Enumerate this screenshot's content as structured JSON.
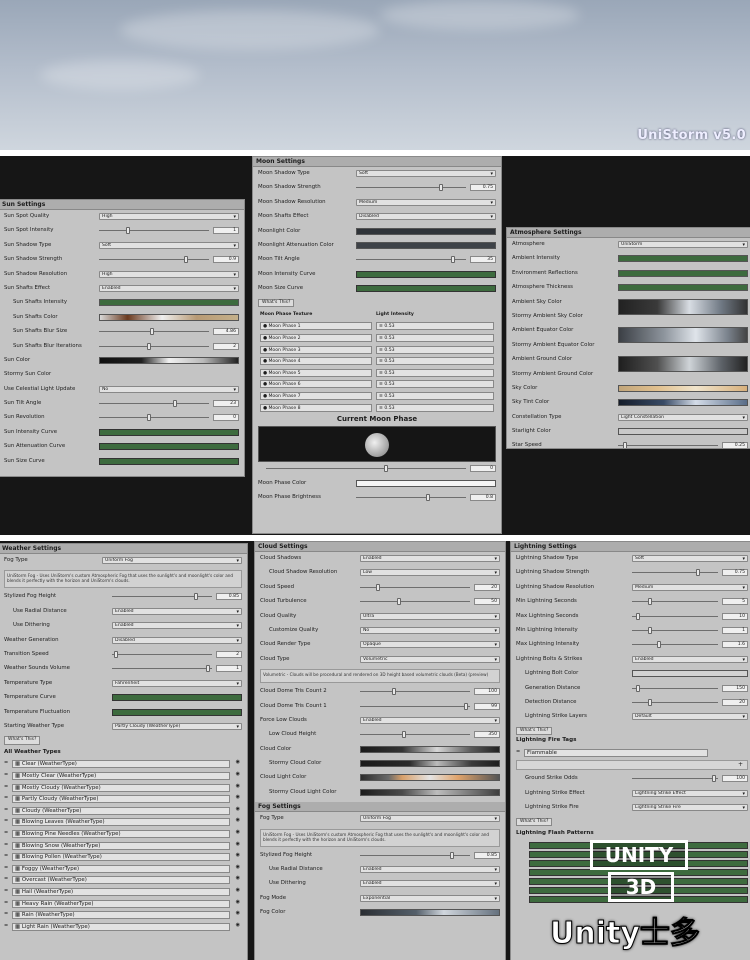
{
  "brand": "UniStorm v5.0",
  "sun": {
    "title": "Sun Settings",
    "rows": [
      {
        "label": "Sun Spot Quality",
        "kind": "dd",
        "value": "High"
      },
      {
        "label": "Sun Spot Intensity",
        "kind": "sl",
        "value": "1",
        "pos": 0.25
      },
      {
        "label": "Sun Shadow Type",
        "kind": "dd",
        "value": "Soft"
      },
      {
        "label": "Sun Shadow Strength",
        "kind": "sl",
        "value": "0.9",
        "pos": 0.8
      },
      {
        "label": "Sun Shadow Resolution",
        "kind": "dd",
        "value": "High"
      },
      {
        "label": "Sun Shafts Effect",
        "kind": "dd",
        "value": "Enabled"
      },
      {
        "label": "Sun Shafts Intensity",
        "kind": "color",
        "color": "#3d6b3e",
        "ind": true
      },
      {
        "label": "Sun Shafts Color",
        "kind": "grad",
        "color": "linear-gradient(90deg,#d8d8d8,#6b3a1f 20%,#efefef 45%,#b89a75 70%,#c4b08a)",
        "ind": true
      },
      {
        "label": "Sun Shafts Blur Size",
        "kind": "sl",
        "value": "4.86",
        "pos": 0.48,
        "ind": true
      },
      {
        "label": "Sun Shafts Blur Iterations",
        "kind": "sl",
        "value": "2",
        "pos": 0.45,
        "ind": true
      },
      {
        "label": "Sun Color",
        "kind": "grad",
        "color": "linear-gradient(90deg,#101010,#202020 30%,#f1f1f1 50%,#b9b9b9 75%,#222)"
      },
      {
        "label": "Stormy Sun Color",
        "kind": "none"
      },
      {
        "label": "Use Celestial Light Update",
        "kind": "dd",
        "value": "No"
      },
      {
        "label": "Sun Tilt Angle",
        "kind": "sl",
        "value": "23",
        "pos": 0.7
      },
      {
        "label": "Sun Revolution",
        "kind": "sl",
        "value": "0",
        "pos": 0.45
      },
      {
        "label": "Sun Intensity Curve",
        "kind": "curve"
      },
      {
        "label": "Sun Attenuation Curve",
        "kind": "curve"
      },
      {
        "label": "Sun Size Curve",
        "kind": "curve"
      }
    ]
  },
  "moon": {
    "title": "Moon Settings",
    "rows": [
      {
        "label": "Moon Shadow Type",
        "kind": "dd",
        "value": "Soft"
      },
      {
        "label": "Moon Shadow Strength",
        "kind": "sl",
        "value": "0.75",
        "pos": 0.78
      },
      {
        "label": "Moon Shadow Resolution",
        "kind": "dd",
        "value": "Medium"
      },
      {
        "label": "Moon Shafts Effect",
        "kind": "dd",
        "value": "Disabled"
      },
      {
        "label": "Moonlight Color",
        "kind": "color",
        "color": "#2f3338"
      },
      {
        "label": "Moonlight Attenuation Color",
        "kind": "color",
        "color": "#3e4248"
      },
      {
        "label": "Moon Tilt Angle",
        "kind": "sl",
        "value": "35",
        "pos": 0.9
      },
      {
        "label": "Moon Intensity Curve",
        "kind": "curve"
      },
      {
        "label": "Moon Size Curve",
        "kind": "curve"
      }
    ],
    "whats_this": "What's This?",
    "col_feature": "Moon Phase Texture",
    "col_intensity": "Light Intensity",
    "phases": [
      {
        "name": "Moon Phase 1",
        "val": "0.53"
      },
      {
        "name": "Moon Phase 2",
        "val": "0.53"
      },
      {
        "name": "Moon Phase 3",
        "val": "0.53"
      },
      {
        "name": "Moon Phase 4",
        "val": "0.53"
      },
      {
        "name": "Moon Phase 5",
        "val": "0.53"
      },
      {
        "name": "Moon Phase 6",
        "val": "0.53"
      },
      {
        "name": "Moon Phase 7",
        "val": "0.53"
      },
      {
        "name": "Moon Phase 8",
        "val": "0.53"
      }
    ],
    "current_phase": "Current Moon Phase",
    "phase_slider": "0",
    "phase_color_label": "Moon Phase Color",
    "phase_brightness_label": "Moon Phase Brightness",
    "phase_brightness": "0.8"
  },
  "atmo": {
    "title": "Atmosphere Settings",
    "rows": [
      {
        "label": "Atmosphere",
        "kind": "dd",
        "value": "UniStorm"
      },
      {
        "label": "Ambient Intensity",
        "kind": "color",
        "color": "#3d6b3e"
      },
      {
        "label": "Environment Reflections",
        "kind": "color",
        "color": "#3d6b3e"
      },
      {
        "label": "Atmosphere Thickness",
        "kind": "color",
        "color": "#3d6b3e"
      },
      {
        "label": "Ambient Sky Color",
        "kind": "grad2",
        "color": "linear-gradient(90deg,#222,#3a3a3a 30%,#d8dde3 55%,#6f7883 80%,#333)"
      },
      {
        "label": "Stormy Ambient Sky Color",
        "kind": "none"
      },
      {
        "label": "Ambient Equator Color",
        "kind": "grad2",
        "color": "linear-gradient(90deg,#3b3f45,#8d949c 35%,#dfe4ea 60%,#7a828c 85%,#444)"
      },
      {
        "label": "Stormy Ambient Equator Color",
        "kind": "none"
      },
      {
        "label": "Ambient Ground Color",
        "kind": "grad2",
        "color": "linear-gradient(90deg,#1f1f1f,#505050 30%,#cfd4d8 55%,#5d6268 80%,#222)"
      },
      {
        "label": "Stormy Ambient Ground Color",
        "kind": "none"
      },
      {
        "label": "Sky Color",
        "kind": "grad",
        "color": "linear-gradient(90deg,#c1a57a,#e1c08e 30%,#f0e4cb 60%,#d8b07c)"
      },
      {
        "label": "Sky Tint Color",
        "kind": "grad",
        "color": "linear-gradient(90deg,#141c2a,#394b66 35%,#d4dce8 60%,#596d88)"
      },
      {
        "label": "Constellation Type",
        "kind": "dd",
        "value": "Light Constellation"
      },
      {
        "label": "Starlight Color",
        "kind": "color",
        "color": "#c9c9c9"
      },
      {
        "label": "Star Speed",
        "kind": "sl",
        "value": "0.25",
        "pos": 0.05
      }
    ]
  },
  "weather": {
    "title": "Weather Settings",
    "fog_type_label": "Fog Type",
    "fog_type": "Uniform Fog",
    "help": "UniStorm Fog - Uses UniStorm's custom Atmospheric Fog that uses the sunlight's and moonlight's color and blends it perfectly with the horizon and UniStorm's clouds.",
    "rows": [
      {
        "label": "Stylized Fog Height",
        "kind": "sl",
        "value": "0.85",
        "pos": 0.85
      },
      {
        "label": "Use Radial Distance",
        "kind": "dd",
        "value": "Enabled",
        "ind": true
      },
      {
        "label": "Use Dithering",
        "kind": "dd",
        "value": "Enabled",
        "ind": true
      },
      {
        "label": "Weather Generation",
        "kind": "dd",
        "value": "Disabled"
      },
      {
        "label": "Transition Speed",
        "kind": "sl",
        "value": "2",
        "pos": 0.02
      },
      {
        "label": "Weather Sounds Volume",
        "kind": "sl",
        "value": "1",
        "pos": 0.98
      },
      {
        "label": "Temperature Type",
        "kind": "dd",
        "value": "Fahrenheit"
      },
      {
        "label": "Temperature Curve",
        "kind": "curve"
      },
      {
        "label": "Temperature Fluctuation",
        "kind": "curve"
      },
      {
        "label": "Starting Weather Type",
        "kind": "dd",
        "value": "Partly Cloudy (WeatherType)"
      }
    ],
    "whats_this": "What's This?",
    "all_types": "All Weather Types",
    "types": [
      "Clear (WeatherType)",
      "Mostly Clear (WeatherType)",
      "Mostly Cloudy (WeatherType)",
      "Partly Cloudy (WeatherType)",
      "Cloudy (WeatherType)",
      "Blowing Leaves (WeatherType)",
      "Blowing Pine Needles (WeatherType)",
      "Blowing Snow (WeatherType)",
      "Blowing Pollen (WeatherType)",
      "Foggy (WeatherType)",
      "Overcast (WeatherType)",
      "Hail (WeatherType)",
      "Heavy Rain (WeatherType)",
      "Rain (WeatherType)",
      "Light Rain (WeatherType)"
    ]
  },
  "cloud": {
    "title": "Cloud Settings",
    "rows": [
      {
        "label": "Cloud Shadows",
        "kind": "dd",
        "value": "Enabled"
      },
      {
        "label": "Cloud Shadow Resolution",
        "kind": "dd",
        "value": "Low",
        "ind": true
      },
      {
        "label": "Cloud Speed",
        "kind": "sl",
        "value": "20",
        "pos": 0.15
      },
      {
        "label": "Cloud Turbulence",
        "kind": "sl",
        "value": "50",
        "pos": 0.35
      },
      {
        "label": "Cloud Quality",
        "kind": "dd",
        "value": "Ultra"
      },
      {
        "label": "Customize Quality",
        "kind": "dd",
        "value": "No",
        "ind": true
      },
      {
        "label": "Cloud Render Type",
        "kind": "dd",
        "value": "Opaque"
      },
      {
        "label": "Cloud Type",
        "kind": "dd",
        "value": "Volumetric"
      }
    ],
    "help": "Volumetric - Clouds will be procedural and rendered on 3D height based volumetric clouds (Beta) (preview)",
    "rows2": [
      {
        "label": "Cloud Dome Tris Count 2",
        "kind": "sl",
        "value": "100",
        "pos": 0.3
      },
      {
        "label": "Cloud Dome Tris Count 1",
        "kind": "sl",
        "value": "99",
        "pos": 0.98
      },
      {
        "label": "Force Low Clouds",
        "kind": "dd",
        "value": "Enabled"
      },
      {
        "label": "Low Cloud Height",
        "kind": "sl",
        "value": "350",
        "pos": 0.4,
        "ind": true
      },
      {
        "label": "Cloud Color",
        "kind": "grad",
        "color": "linear-gradient(90deg,#1a1a1a,#343434 30%,#d7d7d7 55%,#595959 80%,#222)"
      },
      {
        "label": "Stormy Cloud Color",
        "kind": "grad",
        "color": "linear-gradient(90deg,#1a1a1a,#2a2a2a 35%,#bcbcbc 55%,#3a3a3a 80%,#1f1f1f)",
        "ind": true
      },
      {
        "label": "Cloud Light Color",
        "kind": "grad",
        "color": "linear-gradient(90deg,#2d2d2d,#6a6a6a 20%,#d8a06a 30%,#e4e4e4 50%,#e0a46c 70%,#555)"
      },
      {
        "label": "Stormy Cloud Light Color",
        "kind": "grad",
        "color": "linear-gradient(90deg,#1c1c1c,#4a4a4a 30%,#bdbdbd 55%,#3e3e3e)",
        "ind": true
      }
    ],
    "fog_title": "Fog Settings",
    "fog_type_label": "Fog Type",
    "fog_type": "Uniform Fog",
    "fog_help": "UniStorm Fog - Uses UniStorm's custom Atmospheric Fog that uses the sunlight's and moonlight's color and blends it perfectly with the horizon and UniStorm's clouds.",
    "fog_rows": [
      {
        "label": "Stylized Fog Height",
        "kind": "sl",
        "value": "0.85",
        "pos": 0.85
      },
      {
        "label": "Use Radial Distance",
        "kind": "dd",
        "value": "Enabled",
        "ind": true
      },
      {
        "label": "Use Dithering",
        "kind": "dd",
        "value": "Enabled",
        "ind": true
      },
      {
        "label": "Fog Mode",
        "kind": "dd",
        "value": "Exponential"
      },
      {
        "label": "Fog Color",
        "kind": "grad",
        "color": "linear-gradient(90deg,#2a2e33,#55606b 40%,#d0d6dd 60%,#65717e)"
      }
    ]
  },
  "lightning": {
    "title": "Lightning Settings",
    "rows": [
      {
        "label": "Lightning Shadow Type",
        "kind": "dd",
        "value": "Soft"
      },
      {
        "label": "Lightning Shadow Strength",
        "kind": "sl",
        "value": "0.75",
        "pos": 0.78
      },
      {
        "label": "Lightning Shadow Resolution",
        "kind": "dd",
        "value": "Medium"
      },
      {
        "label": "Min Lightning Seconds",
        "kind": "sl",
        "value": "5",
        "pos": 0.2
      },
      {
        "label": "Max Lightning Seconds",
        "kind": "sl",
        "value": "10",
        "pos": 0.05
      },
      {
        "label": "Min Lightning Intensity",
        "kind": "sl",
        "value": "1",
        "pos": 0.2
      },
      {
        "label": "Max Lightning Intensity",
        "kind": "sl",
        "value": "1.6",
        "pos": 0.3
      },
      {
        "label": "Lightning Bolts & Strikes",
        "kind": "dd",
        "value": "Enabled"
      },
      {
        "label": "Lightning Bolt Color",
        "kind": "color",
        "color": "#d2d2d2",
        "ind": true
      },
      {
        "label": "Generation Distance",
        "kind": "sl",
        "value": "150",
        "pos": 0.05,
        "ind": true
      },
      {
        "label": "Detection Distance",
        "kind": "sl",
        "value": "20",
        "pos": 0.2,
        "ind": true
      },
      {
        "label": "Lightning Strike Layers",
        "kind": "dd",
        "value": "Default",
        "ind": true
      }
    ],
    "whats_this": "What's This?",
    "fire_tags": "Lightning Fire Tags",
    "fire_tag": "Flammable",
    "rows2": [
      {
        "label": "Ground Strike Odds",
        "kind": "sl",
        "value": "100",
        "pos": 0.98,
        "ind": true
      },
      {
        "label": "Lightning Strike Effect",
        "kind": "dd",
        "value": "Lightning Strike Effect",
        "ind": true
      },
      {
        "label": "Lightning Strike Fire",
        "kind": "dd",
        "value": "Lightning Strike Fire",
        "ind": true
      }
    ],
    "whats_this2": "What's This?",
    "flash_title": "Lightning Flash Patterns"
  },
  "watermark": {
    "line1": "UNITY",
    "line2": "3D",
    "line3": "Unity士多"
  }
}
